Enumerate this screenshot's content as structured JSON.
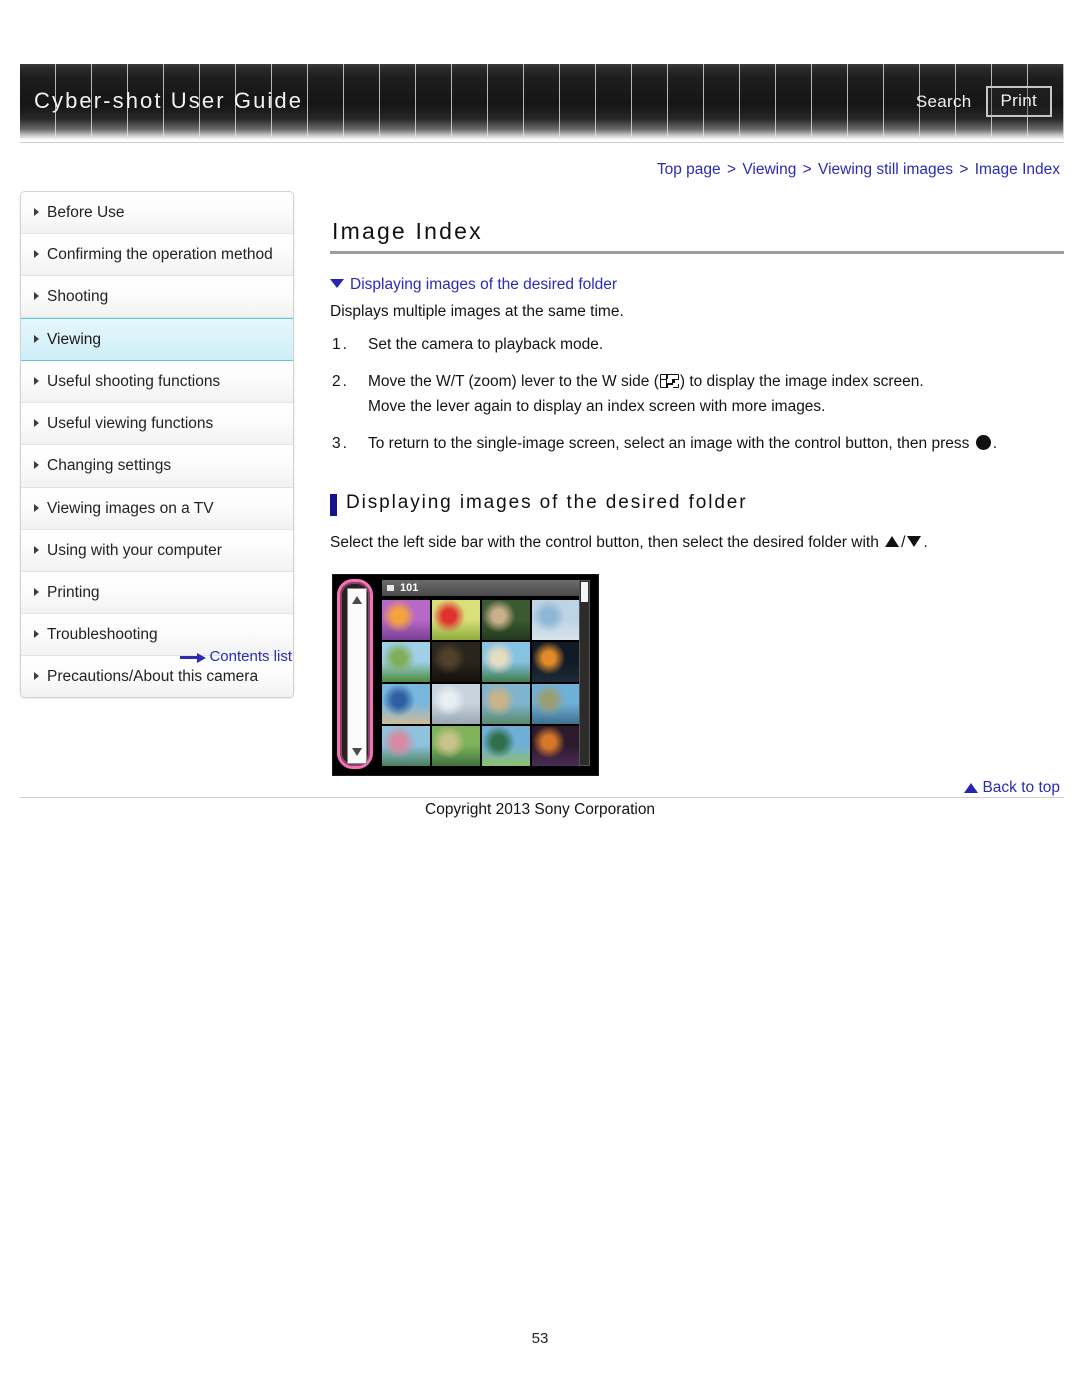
{
  "header": {
    "title": "Cyber-shot User Guide",
    "search_label": "Search",
    "print_label": "Print"
  },
  "breadcrumb": {
    "items": [
      "Top page",
      "Viewing",
      "Viewing still images",
      "Image Index"
    ],
    "separator": ">"
  },
  "sidebar": {
    "items": [
      {
        "label": "Before Use",
        "active": false
      },
      {
        "label": "Confirming the operation method",
        "active": false
      },
      {
        "label": "Shooting",
        "active": false
      },
      {
        "label": "Viewing",
        "active": true
      },
      {
        "label": "Useful shooting functions",
        "active": false
      },
      {
        "label": "Useful viewing functions",
        "active": false
      },
      {
        "label": "Changing settings",
        "active": false
      },
      {
        "label": "Viewing images on a TV",
        "active": false
      },
      {
        "label": "Using with your computer",
        "active": false
      },
      {
        "label": "Printing",
        "active": false
      },
      {
        "label": "Troubleshooting",
        "active": false
      },
      {
        "label": "Precautions/About this camera",
        "active": false
      }
    ],
    "contents_list_label": "Contents list"
  },
  "main": {
    "title": "Image Index",
    "anchor_link": "Displaying images of the desired folder",
    "lead": "Displays multiple images at the same time.",
    "steps": [
      {
        "num": "1.",
        "text_before": "Set the camera to playback mode.",
        "icon": "",
        "text_after": "",
        "second_line": ""
      },
      {
        "num": "2.",
        "text_before": "Move the W/T (zoom) lever to the W side (",
        "icon": "index-icon",
        "text_after": ") to display the image index screen.",
        "second_line": "Move the lever again to display an index screen with more images."
      },
      {
        "num": "3.",
        "text_before": "To return to the single-image screen, select an image with the control button, then press ",
        "icon": "dot-icon",
        "text_after": ".",
        "second_line": ""
      }
    ],
    "section_heading": "Displaying images of the desired folder",
    "section_text_before": "Select the left side bar with the control button, then select the desired folder with ",
    "section_text_middle": "/",
    "section_text_after": "."
  },
  "figure": {
    "folder_label": "101",
    "name": "camera-image-index-screen",
    "thumbnails": [
      {
        "alt": "purple flower",
        "c1": "#b768c8",
        "c2": "#f3a43d",
        "c3": "#7a3f96"
      },
      {
        "alt": "red flower",
        "c1": "#d9e07a",
        "c2": "#e0322c",
        "c3": "#8fae3d"
      },
      {
        "alt": "cat",
        "c1": "#3b5a32",
        "c2": "#c9b089",
        "c3": "#24381f"
      },
      {
        "alt": "sky over sea",
        "c1": "#bdd4e6",
        "c2": "#8fb6d4",
        "c3": "#d8e4ea"
      },
      {
        "alt": "tree in field",
        "c1": "#9fd0e8",
        "c2": "#7fae5a",
        "c3": "#4d8a3a"
      },
      {
        "alt": "dark trees",
        "c1": "#2a241c",
        "c2": "#51412c",
        "c3": "#14100c"
      },
      {
        "alt": "palm trees beach",
        "c1": "#86c2e2",
        "c2": "#e5ddc0",
        "c3": "#3f7b4c"
      },
      {
        "alt": "sunset palm",
        "c1": "#0f1a26",
        "c2": "#e08a2a",
        "c3": "#1d2a38"
      },
      {
        "alt": "blue parasol beach",
        "c1": "#79b8dd",
        "c2": "#2e5fa3",
        "c3": "#cdbb9a"
      },
      {
        "alt": "clouds",
        "c1": "#c8d3dc",
        "c2": "#e9eef2",
        "c3": "#9aa8b4"
      },
      {
        "alt": "sand and sea",
        "c1": "#7fb4cf",
        "c2": "#c9b488",
        "c3": "#5a8a6c"
      },
      {
        "alt": "coastal cliff",
        "c1": "#6fb0d8",
        "c2": "#9a9e74",
        "c3": "#3e6f8e"
      },
      {
        "alt": "lagoon flowers",
        "c1": "#8fc2dd",
        "c2": "#d78aa0",
        "c3": "#4a7f5c"
      },
      {
        "alt": "green rocks",
        "c1": "#7fb35a",
        "c2": "#c9c28a",
        "c3": "#3f7040"
      },
      {
        "alt": "palm lagoon",
        "c1": "#6faed6",
        "c2": "#2f6f4a",
        "c3": "#8fc06a"
      },
      {
        "alt": "night city palms",
        "c1": "#2a1a2c",
        "c2": "#d8772a",
        "c3": "#4a2b55"
      }
    ]
  },
  "footer": {
    "back_to_top": "Back to top",
    "copyright": "Copyright 2013 Sony Corporation",
    "page_number": "53"
  },
  "colors": {
    "link": "#2b2bb5",
    "accent_bar": "#14148c",
    "highlight": "#cdeef7",
    "highlight_border": "#5ec8e0",
    "figure_highlight": "#f472b6"
  }
}
